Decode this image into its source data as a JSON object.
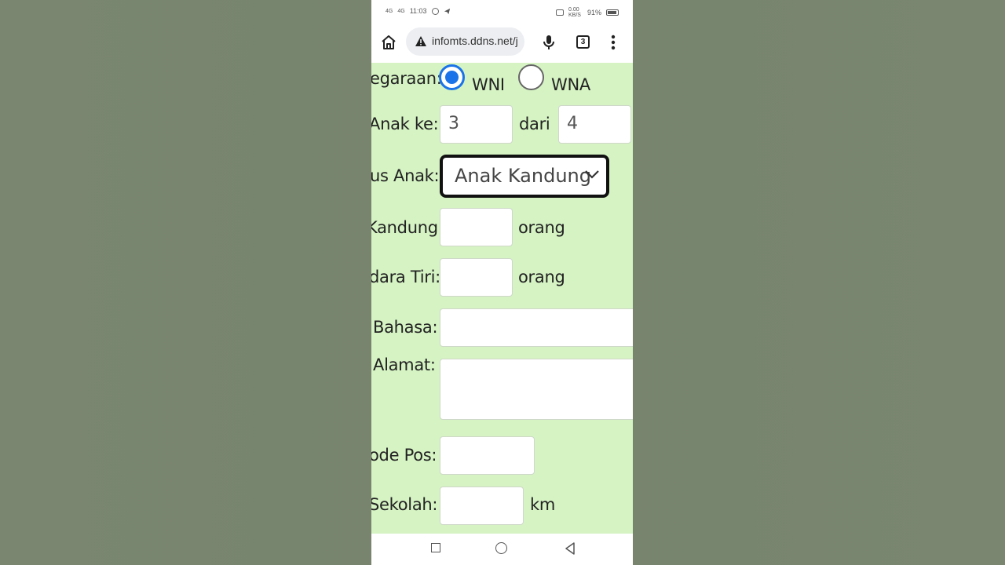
{
  "status_bar": {
    "net1": "4G",
    "net2": "4G",
    "time": "11:03",
    "speed": "0.00 KB/S",
    "battery": "91%"
  },
  "browser": {
    "url": "infomts.ddns.net/j",
    "tab_count": "3"
  },
  "form": {
    "kewarganegaraan_label": "egaraan:",
    "wni_label": "WNI",
    "wna_label": "WNA",
    "wni_checked": true,
    "anak_ke_label": "Anak ke:",
    "anak_ke_value": "3",
    "dari_label": "dari",
    "dari_value": "4",
    "status_anak_label": "us Anak:",
    "status_anak_value": "Anak Kandung",
    "saudara_kandung_label": "Kandung:",
    "saudara_kandung_unit": "orang",
    "saudara_tiri_label": "dara Tiri:",
    "saudara_tiri_unit": "orang",
    "bahasa_label": "Bahasa:",
    "alamat_label": "Alamat:",
    "kode_pos_label": "ode Pos:",
    "jarak_sekolah_label": "Sekolah:",
    "jarak_unit": "km"
  },
  "colors": {
    "form_bg": "#d5f3c3",
    "accent": "#1a73e8",
    "backdrop": "#77846d"
  }
}
